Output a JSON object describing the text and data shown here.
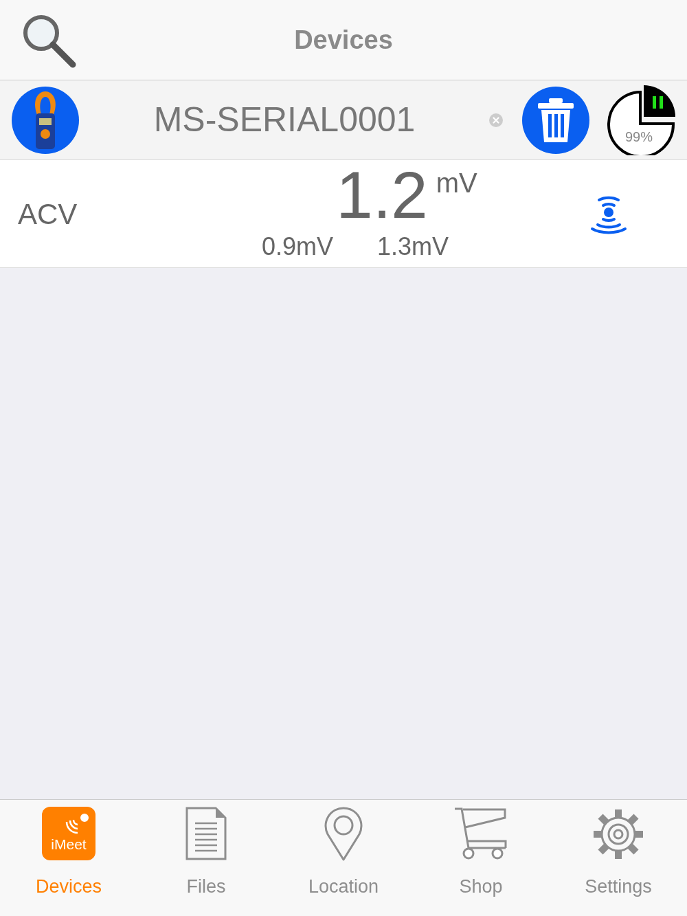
{
  "header": {
    "title": "Devices"
  },
  "device": {
    "name": "MS-SERIAL0001",
    "battery": "99%",
    "paused": true
  },
  "reading": {
    "mode": "ACV",
    "value": "1.2",
    "unit": "mV",
    "min": "0.9mV",
    "max": "1.3mV"
  },
  "tabs": [
    {
      "kind": "imeet",
      "label": "Devices",
      "icon_text": "iMeet",
      "selected": true
    },
    {
      "kind": "files",
      "label": "Files",
      "selected": false
    },
    {
      "kind": "location",
      "label": "Location",
      "selected": false
    },
    {
      "kind": "shop",
      "label": "Shop",
      "selected": false
    },
    {
      "kind": "settings",
      "label": "Settings",
      "selected": false
    }
  ]
}
